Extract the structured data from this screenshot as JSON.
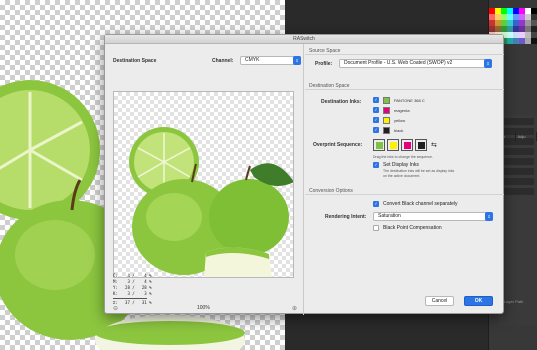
{
  "dialog": {
    "title": "RASwitch",
    "destination_space_label": "Destination Space",
    "channel_label": "Channel:",
    "channel_value": "CMYK",
    "zoom_minus": "⊖",
    "zoom_value": "100%",
    "zoom_plus": "⊕",
    "source_space": {
      "heading": "Source Space",
      "profile_label": "Profile:",
      "profile_value": "Document Profile - U.S. Web Coated (SWOP) v2"
    },
    "destination_space": {
      "heading": "Destination Space",
      "inks_label": "Destination Inks:",
      "inks": [
        {
          "name": "PANTONE 368 C",
          "color": "#7dc242",
          "checked": true
        },
        {
          "name": "magenta",
          "color": "#e6007e",
          "checked": true
        },
        {
          "name": "yellow",
          "color": "#fff200",
          "checked": true
        },
        {
          "name": "black",
          "color": "#231f20",
          "checked": true
        }
      ],
      "overprint_label": "Overprint Sequence:",
      "overprint_colors": [
        "#7dc242",
        "#fff200",
        "#e6007e",
        "#231f20"
      ],
      "drag_note": "Drag the inks to change the sequence.",
      "set_display_label": "Set Display Inks",
      "set_display_note_1": "The destination inks will be set as display inks",
      "set_display_note_2": "on the active document."
    },
    "conversion": {
      "heading": "Conversion Options",
      "convert_black_label": "Convert Black channel separately",
      "rendering_label": "Rendering Intent:",
      "rendering_value": "Saturation",
      "bpc_label": "Black Point Compensation"
    },
    "info": {
      "c": "C:    4 /    4 %",
      "m": "M:    3 /    4 %",
      "y": "Y:   28 /   28 %",
      "k": "K:    3 /    3 %",
      "s": "Σ:   37 /   31 %"
    },
    "cancel_label": "Cancel",
    "ok_label": "OK"
  },
  "workspace": {
    "panel_tabs": [
      "ation",
      "Adju"
    ],
    "panel_footer": "Layer Path"
  }
}
